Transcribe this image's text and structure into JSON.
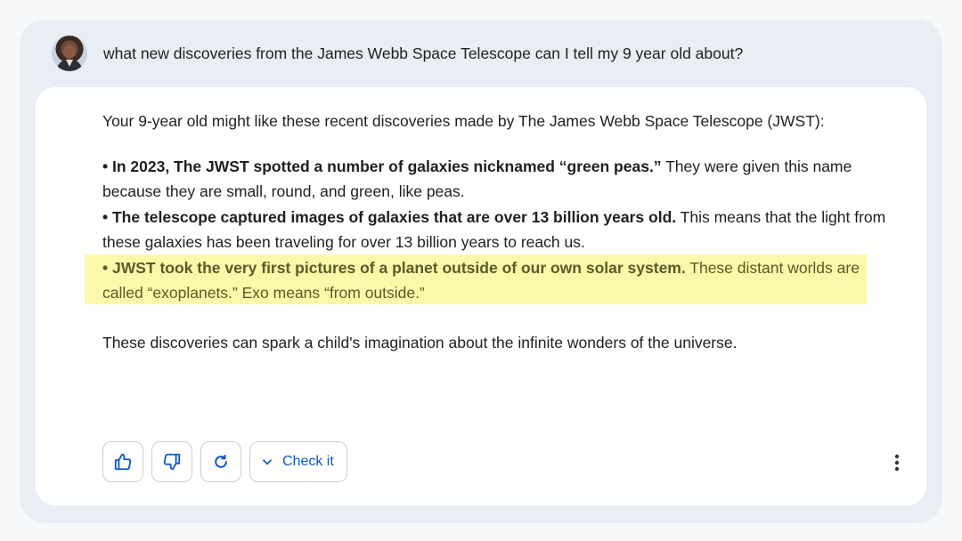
{
  "prompt": {
    "text": "what new discoveries from the James Webb Space Telescope can I tell my 9 year old about?"
  },
  "response": {
    "intro": "Your 9-year old might like these recent discoveries made by The James Webb Space Telescope (JWST):",
    "bullets": [
      {
        "bold": "• In 2023, The JWST spotted a number of galaxies nicknamed “green peas.”",
        "text": " They were given this name because they are small, round, and green, like peas."
      },
      {
        "bold": "• The telescope captured images of galaxies that are over 13 billion years old.",
        "text": " This means that the light from these galaxies has been traveling for over 13 billion years to reach us."
      },
      {
        "bold": "• JWST took the very first pictures of a planet outside of our own solar system.",
        "text": " These distant worlds are called “exoplanets.” Exo means “from outside.”"
      }
    ],
    "closing": "These discoveries can spark a child's imagination about the infinite wonders of the universe."
  },
  "actions": {
    "thumbs_up_icon": "thumbs-up-icon",
    "thumbs_down_icon": "thumbs-down-icon",
    "regenerate_icon": "refresh-icon",
    "check_label": "Check it",
    "more_icon": "more-vert-icon"
  },
  "colors": {
    "accent": "#0b57d0",
    "highlight": "#fbf79a"
  }
}
